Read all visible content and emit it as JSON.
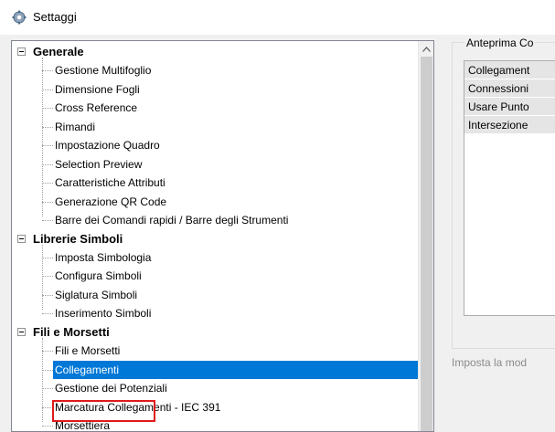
{
  "window": {
    "title": "Settaggi",
    "icon": "gear-icon"
  },
  "tree": {
    "categories": [
      {
        "label": "Generale",
        "items": [
          "Gestione Multifoglio",
          "Dimensione Fogli",
          "Cross Reference",
          "Rimandi",
          "Impostazione Quadro",
          "Selection Preview",
          "Caratteristiche Attributi",
          "Generazione QR Code",
          "Barre dei Comandi rapidi / Barre degli Strumenti"
        ]
      },
      {
        "label": "Librerie Simboli",
        "items": [
          "Imposta Simbologia",
          "Configura Simboli",
          "Siglatura Simboli",
          "Inserimento Simboli"
        ]
      },
      {
        "label": "Fili e Morsetti",
        "items": [
          "Fili e Morsetti",
          "Collegamenti",
          "Gestione dei Potenziali",
          "Marcatura Collegamenti - IEC 391",
          "Morsettiera"
        ]
      }
    ],
    "selected": "Collegamenti"
  },
  "preview": {
    "title": "Anteprima Co",
    "items": [
      "Collegament",
      "Connessioni",
      "Usare Punto",
      "Intersezione"
    ]
  },
  "status_text": "Imposta la mod"
}
